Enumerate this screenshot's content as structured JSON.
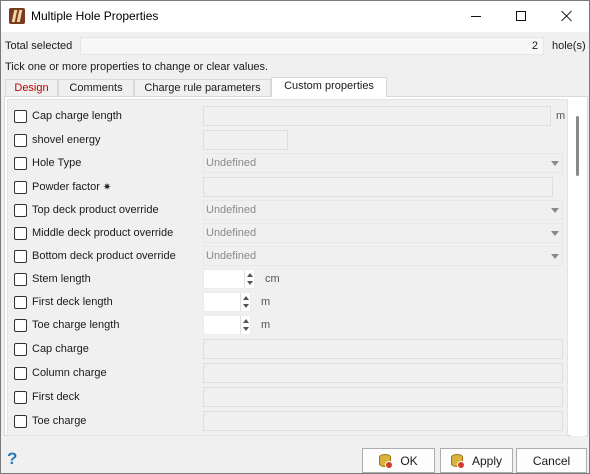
{
  "window": {
    "title": "Multiple Hole Properties",
    "controls": {
      "minimize": "minimize-icon",
      "maximize": "maximize-icon",
      "close": "close-icon"
    }
  },
  "total": {
    "label": "Total selected",
    "value": "2",
    "unit": "hole(s)"
  },
  "hint": "Tick one or more properties to change or clear values.",
  "tabs": [
    {
      "label": "Design",
      "active": false
    },
    {
      "label": "Comments",
      "active": false
    },
    {
      "label": "Charge rule parameters",
      "active": false
    },
    {
      "label": "Custom properties",
      "active": true
    }
  ],
  "rows": [
    {
      "label": "Cap charge length",
      "checked": false,
      "unit": "m"
    },
    {
      "label": "shovel energy",
      "checked": false
    },
    {
      "label": "Hole Type",
      "checked": false,
      "value": "Undefined"
    },
    {
      "label": "Powder factor",
      "checked": false,
      "marker": "✷"
    },
    {
      "label": "Top deck product override",
      "checked": false,
      "value": "Undefined"
    },
    {
      "label": "Middle deck product override",
      "checked": false,
      "value": "Undefined"
    },
    {
      "label": "Bottom deck product override",
      "checked": false,
      "value": "Undefined"
    },
    {
      "label": "Stem length",
      "checked": false,
      "unit": "cm"
    },
    {
      "label": "First deck length",
      "checked": false,
      "unit": "m"
    },
    {
      "label": "Toe charge length",
      "checked": false,
      "unit": "m"
    },
    {
      "label": "Cap charge",
      "checked": false
    },
    {
      "label": "Column charge",
      "checked": false
    },
    {
      "label": "First deck",
      "checked": false
    },
    {
      "label": "Toe charge",
      "checked": false
    }
  ],
  "buttons": {
    "help": "?",
    "ok": "OK",
    "apply": "Apply",
    "cancel": "Cancel"
  },
  "colors": {
    "active_tab_label": "#c00000",
    "help_icon": "#2a7ab8"
  }
}
